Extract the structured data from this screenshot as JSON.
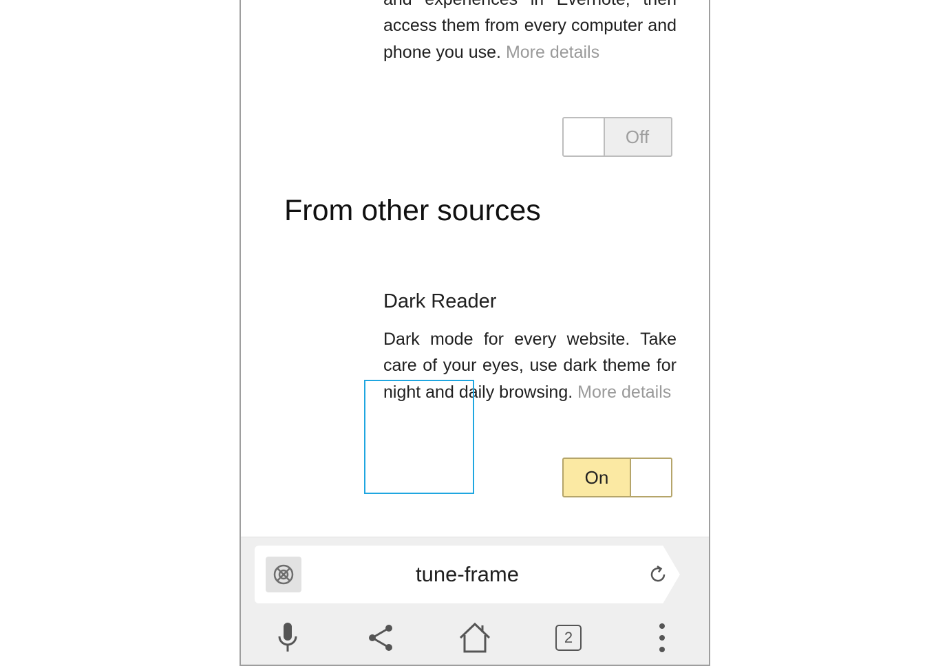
{
  "extension_1": {
    "description_partial_top": "and experiences in Evernote, then",
    "description": "access them from every computer and phone you use.",
    "more_details": "More details",
    "toggle_label": "Off"
  },
  "section": {
    "heading": "From other sources"
  },
  "extension_2": {
    "name": "Dark Reader",
    "description": "Dark mode for every website. Take care of your eyes, use dark theme for night and daily browsing.",
    "more_details": "More details",
    "toggle_label": "On"
  },
  "address_bar": {
    "url": "tune-frame",
    "security_icon": "blocked-circle-icon",
    "reload_icon": "reload-icon"
  },
  "toolbar": {
    "tab_count": "2",
    "icons": [
      "microphone-icon",
      "share-icon",
      "home-icon",
      "tabs-icon",
      "more-vert-icon"
    ]
  },
  "colors": {
    "toggle_on_bg": "#fbe9a3",
    "toggle_off_bg": "#eeeeee",
    "link_gray": "#9a9a9a",
    "highlight": "#1fa6e0"
  }
}
